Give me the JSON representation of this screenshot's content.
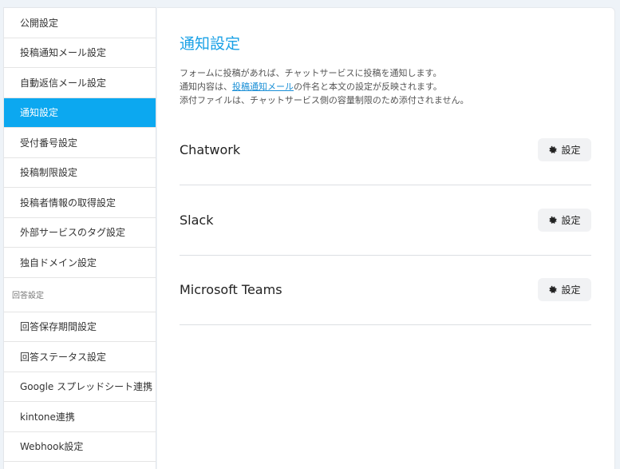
{
  "sidebar": {
    "items_top": [
      {
        "label": "公開設定",
        "active": false
      },
      {
        "label": "投稿通知メール設定",
        "active": false
      },
      {
        "label": "自動返信メール設定",
        "active": false
      },
      {
        "label": "通知設定",
        "active": true
      },
      {
        "label": "受付番号設定",
        "active": false
      },
      {
        "label": "投稿制限設定",
        "active": false
      },
      {
        "label": "投稿者情報の取得設定",
        "active": false
      },
      {
        "label": "外部サービスのタグ設定",
        "active": false
      },
      {
        "label": "独自ドメイン設定",
        "active": false
      }
    ],
    "section_label": "回答設定",
    "items_bottom": [
      {
        "label": "回答保存期間設定"
      },
      {
        "label": "回答ステータス設定"
      },
      {
        "label": "Google スプレッドシート連携"
      },
      {
        "label": "kintone連携"
      },
      {
        "label": "Webhook設定"
      }
    ]
  },
  "main": {
    "title": "通知設定",
    "desc_line1": "フォームに投稿があれば、チャットサービスに投稿を通知します。",
    "desc_line2_pre": "通知内容は、",
    "desc_line2_link": "投稿通知メール",
    "desc_line2_post": "の件名と本文の設定が反映されます。",
    "desc_line3": "添付ファイルは、チャットサービス側の容量制限のため添付されません。",
    "services": [
      {
        "name": "Chatwork",
        "button_label": "設定"
      },
      {
        "name": "Slack",
        "button_label": "設定"
      },
      {
        "name": "Microsoft Teams",
        "button_label": "設定"
      }
    ]
  },
  "colors": {
    "accent": "#0ca8f0",
    "title": "#1aa1e6"
  },
  "icons": {
    "settings": "gear-icon"
  }
}
